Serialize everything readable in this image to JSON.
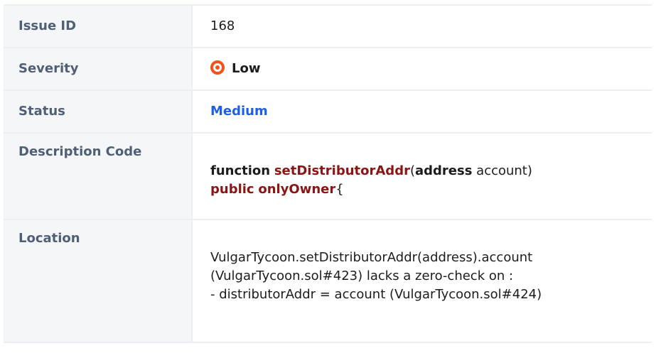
{
  "rows": {
    "issue_id": {
      "label": "Issue ID",
      "value": "168"
    },
    "severity": {
      "label": "Severity",
      "value": "Low",
      "icon": "severity-low-icon",
      "icon_color": "#f0531c"
    },
    "status": {
      "label": "Status",
      "value": "Medium",
      "value_color": "#1e5ee6"
    },
    "description": {
      "label": "Description Code",
      "code": {
        "kw_function": "function",
        "fn_name": "setDistributorAddr",
        "paren_open": "(",
        "kw_address": "address",
        "param": " account)",
        "kw_public": "public",
        "kw_only_owner": "onlyOwner",
        "brace": "{"
      },
      "keyword_color": "#8b1414"
    },
    "location": {
      "label": "Location",
      "lines": [
        "VulgarTycoon.setDistributorAddr(address).account",
        "(VulgarTycoon.sol#423) lacks a zero-check on :",
        "- distributorAddr = account (VulgarTycoon.sol#424)"
      ]
    }
  }
}
